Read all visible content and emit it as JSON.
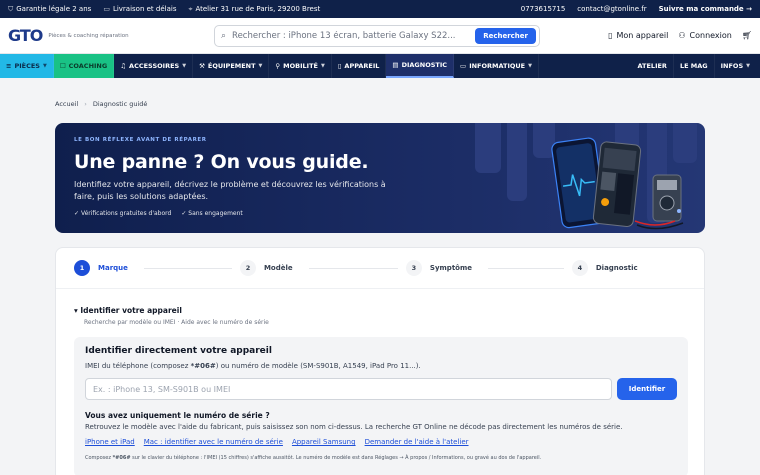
{
  "topbar": {
    "warranty": "Garantie légale 2 ans",
    "delivery": "Livraison et délais",
    "address": "Atelier 31 rue de Paris, 29200 Brest",
    "phone": "0773615715",
    "email": "contact@gtonline.fr",
    "track": "Suivre ma commande →"
  },
  "header": {
    "logo_text": "GTO",
    "logo_tagline": "Pièces & coaching réparation",
    "search_placeholder": "Rechercher : iPhone 13 écran, batterie Galaxy S22...",
    "search_button": "Rechercher",
    "my_device": "Mon appareil",
    "login": "Connexion"
  },
  "nav": {
    "items": [
      {
        "label": "PIÈCES"
      },
      {
        "label": "COACHING"
      },
      {
        "label": "ACCESSOIRES"
      },
      {
        "label": "ÉQUIPEMENT"
      },
      {
        "label": "MOBILITÉ"
      },
      {
        "label": "APPAREIL"
      },
      {
        "label": "DIAGNOSTIC"
      },
      {
        "label": "INFORMATIQUE"
      }
    ],
    "right": [
      {
        "label": "ATELIER"
      },
      {
        "label": "LE MAG"
      },
      {
        "label": "INFOS"
      }
    ]
  },
  "breadcrumb": {
    "home": "Accueil",
    "current": "Diagnostic guidé"
  },
  "hero": {
    "kicker": "LE BON RÉFLEXE AVANT DE RÉPARER",
    "title": "Une panne ? On vous guide.",
    "description": "Identifiez votre appareil, décrivez le problème et découvrez les vérifications à faire, puis les solutions adaptées.",
    "check1": "Vérifications gratuites d'abord",
    "check2": "Sans engagement"
  },
  "steps": [
    {
      "num": "1",
      "label": "Marque"
    },
    {
      "num": "2",
      "label": "Modèle"
    },
    {
      "num": "3",
      "label": "Symptôme"
    },
    {
      "num": "4",
      "label": "Diagnostic"
    }
  ],
  "identify": {
    "heading": "Identifier votre appareil",
    "subtitle": "Recherche par modèle ou IMEI · Aide avec le numéro de série",
    "panel_title": "Identifier directement votre appareil",
    "panel_desc_a": "IMEI du téléphone (composez ",
    "panel_desc_code": "*#06#",
    "panel_desc_b": ") ou numéro de modèle (SM-S901B, A1549, iPad Pro 11...).",
    "input_placeholder": "Ex. : iPhone 13, SM-S901B ou IMEI",
    "button": "Identifier",
    "serial_title": "Vous avez uniquement le numéro de série ?",
    "serial_desc": "Retrouvez le modèle avec l'aide du fabricant, puis saisissez son nom ci-dessus. La recherche GT Online ne décode pas directement les numéros de série.",
    "links": [
      "iPhone et iPad",
      "Mac : identifier avec le numéro de série",
      "Appareil Samsung",
      "Demander de l'aide à l'atelier"
    ],
    "foot_a": "Composez ",
    "foot_code": "*#06#",
    "foot_b": " sur le clavier du téléphone : l'IMEI (15 chiffres) s'affiche aussitôt. Le numéro de modèle est dans Réglages → À propos / Informations, ou gravé au dos de l'appareil."
  },
  "colors": {
    "navy": "#0f2149",
    "accent_blue": "#2563eb",
    "pieces_cyan": "#22b8e6",
    "coaching_green": "#19c285"
  }
}
